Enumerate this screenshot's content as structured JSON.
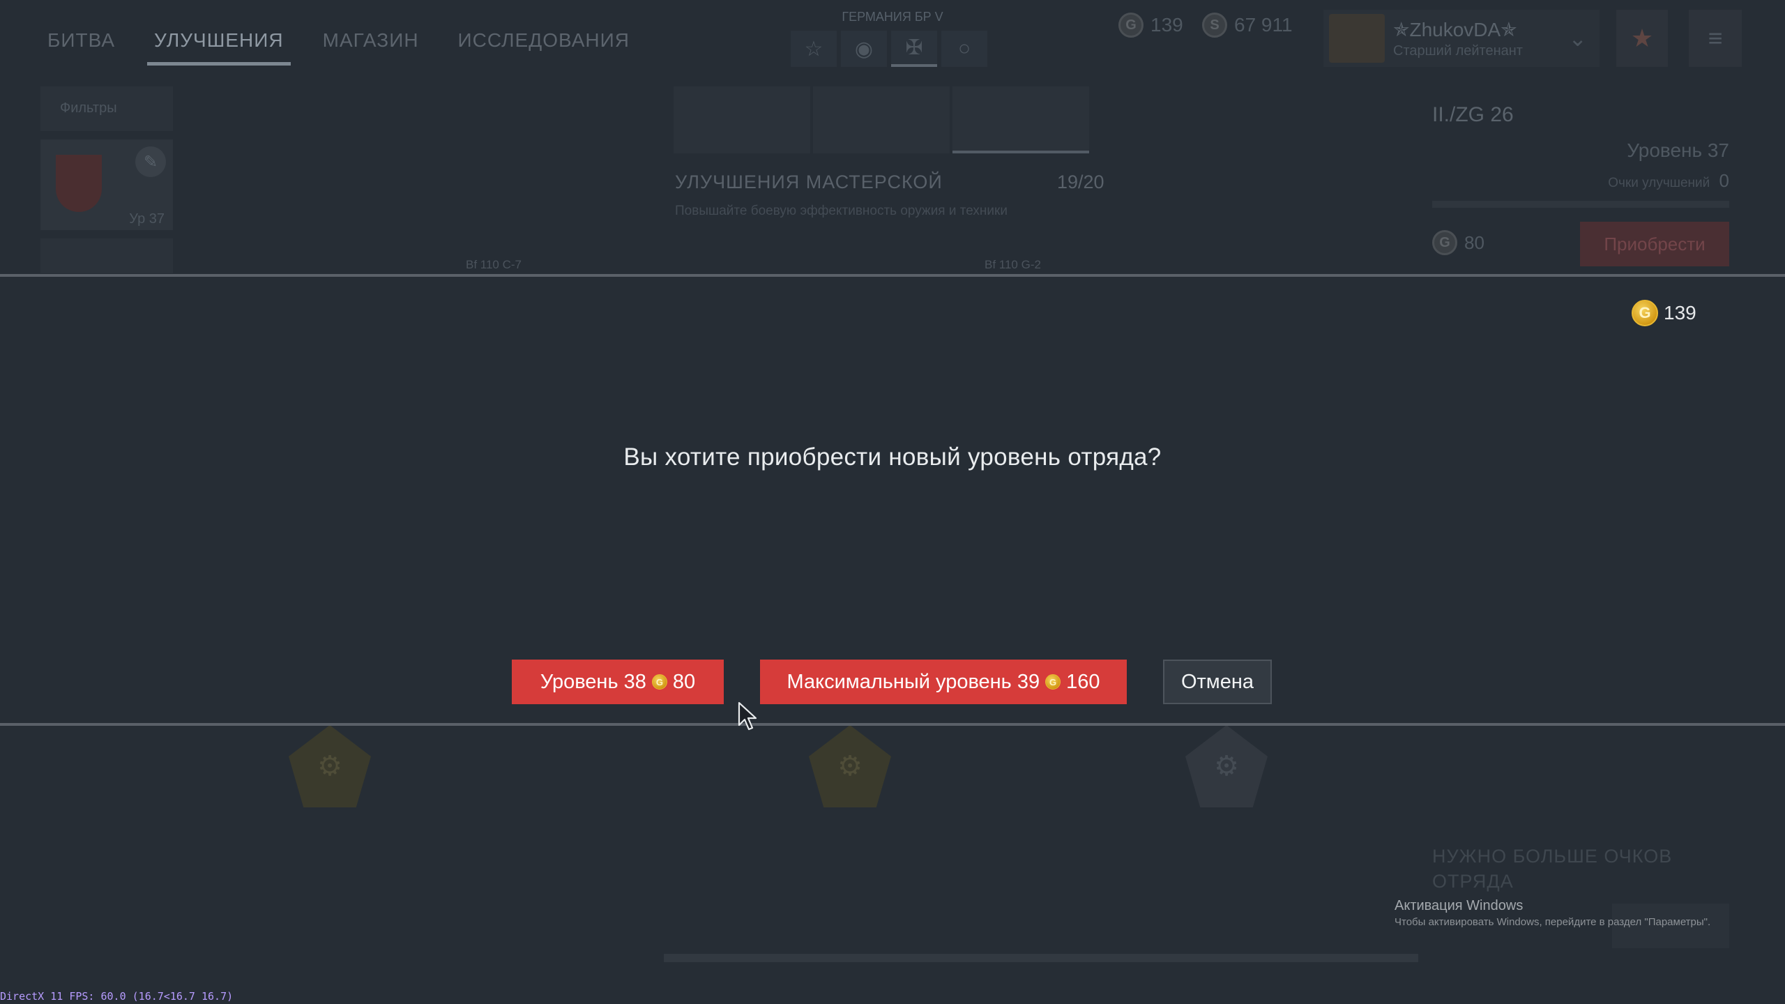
{
  "nav": {
    "tabs": [
      "БИТВА",
      "УЛУЧШЕНИЯ",
      "МАГАЗИН",
      "ИССЛЕДОВАНИЯ"
    ]
  },
  "header": {
    "nation": "ГЕРМАНИЯ БР V",
    "gold": "139",
    "silver": "67 911",
    "player_name": "✯ZhukovDA✯",
    "player_rank": "Старший лейтенант"
  },
  "left": {
    "filters_label": "Фильтры",
    "squad_level": "Ур 37"
  },
  "workshop": {
    "title": "УЛУЧШЕНИЯ МАСТЕРСКОЙ",
    "count": "19/20",
    "description": "Повышайте боевую эффективность оружия и техники",
    "vehicle_left": "Bf 110 C-7",
    "vehicle_right": "Bf 110 G-2"
  },
  "right_panel": {
    "squad_name": "II./ZG 26",
    "level": "Уровень 37",
    "points_label": "Очки улучшений",
    "points_value": "0",
    "price": "80",
    "buy_label": "Приобрести",
    "need_more": "НУЖНО БОЛЬШЕ ОЧКОВ ОТРЯДА"
  },
  "modal": {
    "gold_balance": "139",
    "question": "Вы хотите приобрести новый уровень отряда?",
    "btn_level_label": "Уровень 38",
    "btn_level_price": "80",
    "btn_max_label": "Максимальный уровень 39",
    "btn_max_price": "160",
    "btn_cancel": "Отмена"
  },
  "overlay": {
    "windows_title": "Активация Windows",
    "windows_sub": "Чтобы активировать Windows, перейдите в раздел \"Параметры\".",
    "fps": "DirectX 11 FPS: 60.0 (16.7<16.7 16.7)"
  },
  "colors": {
    "accent_red": "#d63c3a",
    "gold": "#e0a72a",
    "background": "#262d35"
  }
}
